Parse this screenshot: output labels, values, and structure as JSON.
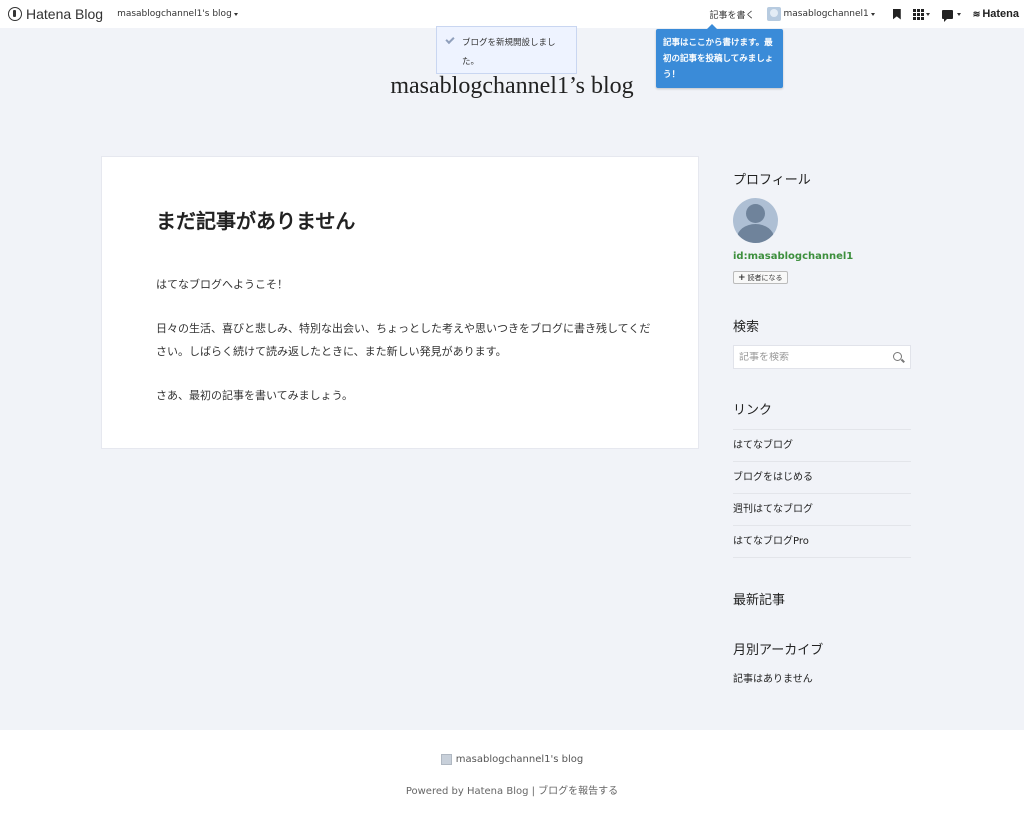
{
  "topbar": {
    "logo": "Hatena Blog",
    "blog_switcher": "masablogchannel1's blog",
    "write_link": "記事を書く",
    "user_name": "masablogchannel1",
    "brand": "Hatena"
  },
  "notice": {
    "text": "ブログを新規開設しました。"
  },
  "tooltip": {
    "text": "記事はここから書けます。最初の記事を投稿してみましょう！"
  },
  "blog": {
    "title": "masablogchannel1’s blog"
  },
  "entry": {
    "title": "まだ記事がありません",
    "paragraphs": [
      "はてなブログへようこそ！",
      "日々の生活、喜びと悲しみ、特別な出会い、ちょっとした考えや思いつきをブログに書き残してください。しばらく続けて読み返したときに、また新しい発見があります。",
      "さあ、最初の記事を書いてみましょう。"
    ]
  },
  "sidebar": {
    "profile": {
      "heading": "プロフィール",
      "user_id": "id:masablogchannel1",
      "follow_label": "読者になる"
    },
    "search": {
      "heading": "検索",
      "placeholder": "記事を検索"
    },
    "links": {
      "heading": "リンク",
      "items": [
        "はてなブログ",
        "ブログをはじめる",
        "週刊はてなブログ",
        "はてなブログPro"
      ]
    },
    "recent": {
      "heading": "最新記事"
    },
    "archive": {
      "heading": "月別アーカイブ",
      "empty": "記事はありません"
    }
  },
  "footer": {
    "blog_name": "masablogchannel1's blog",
    "powered": "Powered by Hatena Blog | ブログを報告する"
  },
  "colors": {
    "background": "#f1f3f8",
    "tooltip": "#3a8bd8",
    "user_id": "#3d8f3d"
  }
}
